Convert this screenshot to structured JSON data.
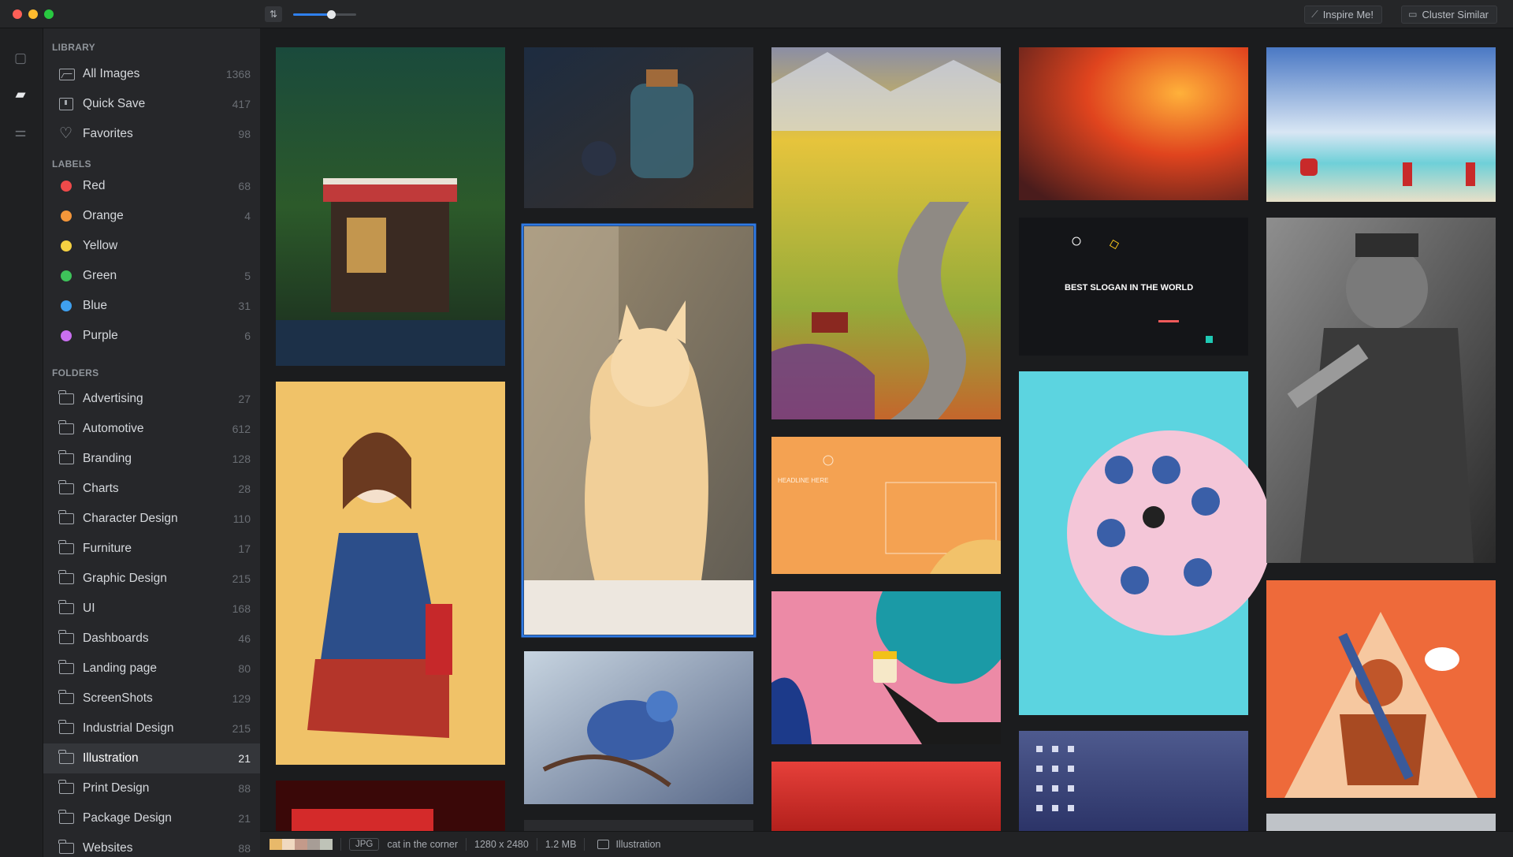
{
  "toolbar": {
    "sort_icon": "sort-icon",
    "zoom_level": 0.6,
    "inspire_label": "Inspire Me!",
    "cluster_label": "Cluster Similar"
  },
  "sidebar": {
    "library_title": "LIBRARY",
    "library": [
      {
        "label": "All Images",
        "count": "1368",
        "icon": "all-images-icon"
      },
      {
        "label": "Quick Save",
        "count": "417",
        "icon": "quick-save-icon"
      },
      {
        "label": "Favorites",
        "count": "98",
        "icon": "heart-icon"
      }
    ],
    "labels_title": "LABELS",
    "labels": [
      {
        "label": "Red",
        "count": "68",
        "color": "#ef4a4a"
      },
      {
        "label": "Orange",
        "count": "4",
        "color": "#f4963a"
      },
      {
        "label": "Yellow",
        "count": "",
        "color": "#f5d142"
      },
      {
        "label": "Green",
        "count": "5",
        "color": "#3ec35a"
      },
      {
        "label": "Blue",
        "count": "31",
        "color": "#3fa0f0"
      },
      {
        "label": "Purple",
        "count": "6",
        "color": "#c96ff0"
      }
    ],
    "folders_title": "FOLDERS",
    "folders": [
      {
        "label": "Advertising",
        "count": "27"
      },
      {
        "label": "Automotive",
        "count": "612"
      },
      {
        "label": "Branding",
        "count": "128"
      },
      {
        "label": "Charts",
        "count": "28"
      },
      {
        "label": "Character Design",
        "count": "110"
      },
      {
        "label": "Furniture",
        "count": "17"
      },
      {
        "label": "Graphic Design",
        "count": "215"
      },
      {
        "label": "UI",
        "count": "168"
      },
      {
        "label": "Dashboards",
        "count": "46"
      },
      {
        "label": "Landing page",
        "count": "80"
      },
      {
        "label": "ScreenShots",
        "count": "129"
      },
      {
        "label": "Industrial Design",
        "count": "215"
      },
      {
        "label": "Illustration",
        "count": "21",
        "selected": true
      },
      {
        "label": "Print Design",
        "count": "88"
      },
      {
        "label": "Package Design",
        "count": "21"
      },
      {
        "label": "Websites",
        "count": "88"
      }
    ]
  },
  "gallery": {
    "banner_text": "BEST SLOGAN IN THE WORLD",
    "headline_text": "HEADLINE HERE"
  },
  "status": {
    "palette": [
      "#e8b96a",
      "#f0d9c0",
      "#c49a8a",
      "#a79d96",
      "#bfc3b8"
    ],
    "format": "JPG",
    "name": "cat in the corner",
    "dimensions": "1280 x 2480",
    "size": "1.2 MB",
    "folder": "Illustration"
  },
  "colors": {
    "accent": "#2f7ae5"
  }
}
